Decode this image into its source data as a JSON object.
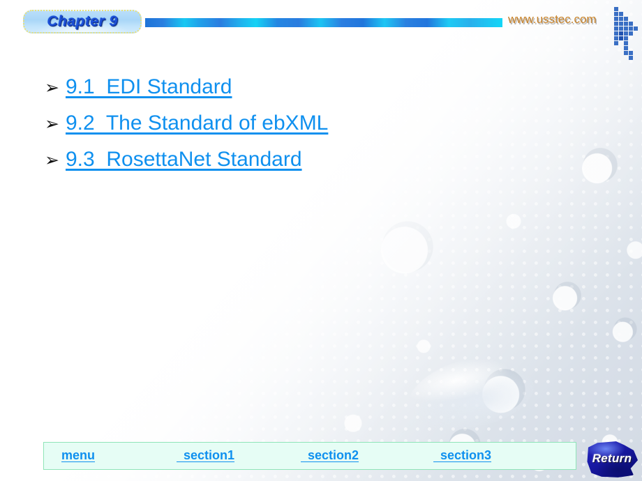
{
  "header": {
    "chapter_badge": "Chapter 9",
    "site_url": "www.usstec.com",
    "logo_icon": "cursor-arrow-mosaic-icon",
    "accent_bar_icon": "gradient-bar"
  },
  "content": {
    "bullet_glyph": "➢",
    "items": [
      {
        "label": "9.1  EDI Standard"
      },
      {
        "label": "9.2  The Standard of ebXML"
      },
      {
        "label": "9.3  RosettaNet Standard"
      }
    ]
  },
  "footer": {
    "links": [
      {
        "label": "menu"
      },
      {
        "label": "  section1"
      },
      {
        "label": "  section2"
      },
      {
        "label": "  section3"
      }
    ],
    "return_button": "Return"
  },
  "colors": {
    "link_blue": "#0f90ef",
    "badge_text_blue": "#1c4fd6",
    "url_orange": "#c8832a",
    "footer_bg": "#e6fdf5",
    "footer_border": "#8fe4b8",
    "return_blue": "#11128c",
    "bar_cyan": "#15d2f5",
    "bar_blue": "#2a7fe0"
  }
}
